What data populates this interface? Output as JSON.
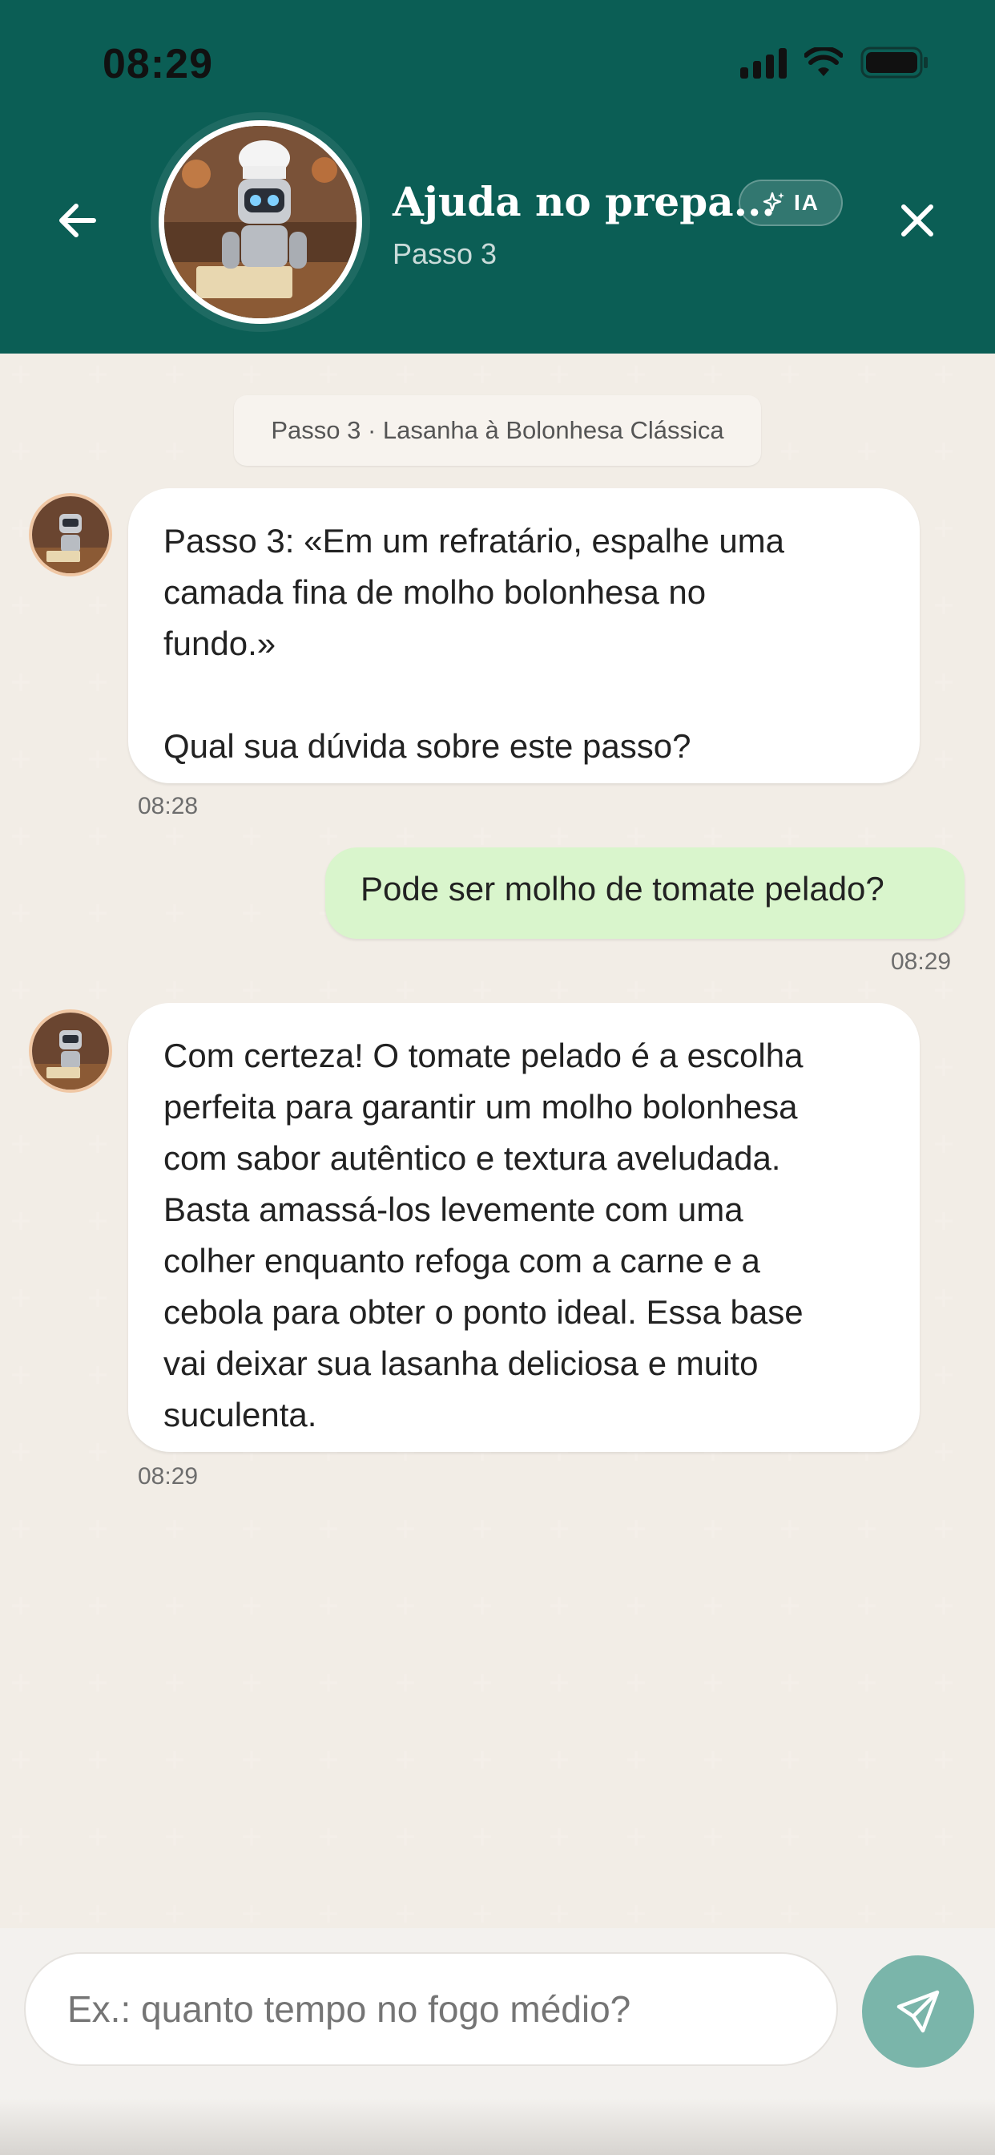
{
  "status_bar": {
    "time": "08:29"
  },
  "header": {
    "title": "Ajuda no prepa...",
    "subtitle": "Passo 3",
    "ai_badge": "IA",
    "back_icon": "arrow-left-icon",
    "close_icon": "close-icon",
    "avatar": "robot-chef-avatar"
  },
  "chat": {
    "step_chip": "Passo 3 · Lasanha à Bolonhesa Clássica",
    "messages": [
      {
        "from": "bot",
        "lines": [
          "Passo 3: «Em um refratário, espalhe uma",
          "camada fina de molho bolonhesa no",
          "fundo.»",
          "",
          "Qual sua dúvida sobre este passo?"
        ],
        "time": "08:28"
      },
      {
        "from": "user",
        "text": "Pode ser molho de tomate pelado?",
        "time": "08:29"
      },
      {
        "from": "bot",
        "lines": [
          "Com certeza! O tomate pelado é a escolha",
          "perfeita para garantir um molho bolonhesa",
          "com sabor autêntico e textura aveludada.",
          "Basta amassá-los levemente com uma",
          "colher enquanto refoga com a carne e a",
          "cebola para obter o ponto ideal. Essa base",
          "vai deixar sua lasanha deliciosa e muito",
          "suculenta."
        ],
        "time": "08:29"
      }
    ]
  },
  "composer": {
    "placeholder": "Ex.: quanto tempo no fogo médio?",
    "send_icon": "send-icon"
  },
  "colors": {
    "header": "#0b5e55",
    "chat_bg": "#e8e0d6",
    "user_bubble": "#d9f5cc",
    "send_button": "#7ab5aa"
  }
}
